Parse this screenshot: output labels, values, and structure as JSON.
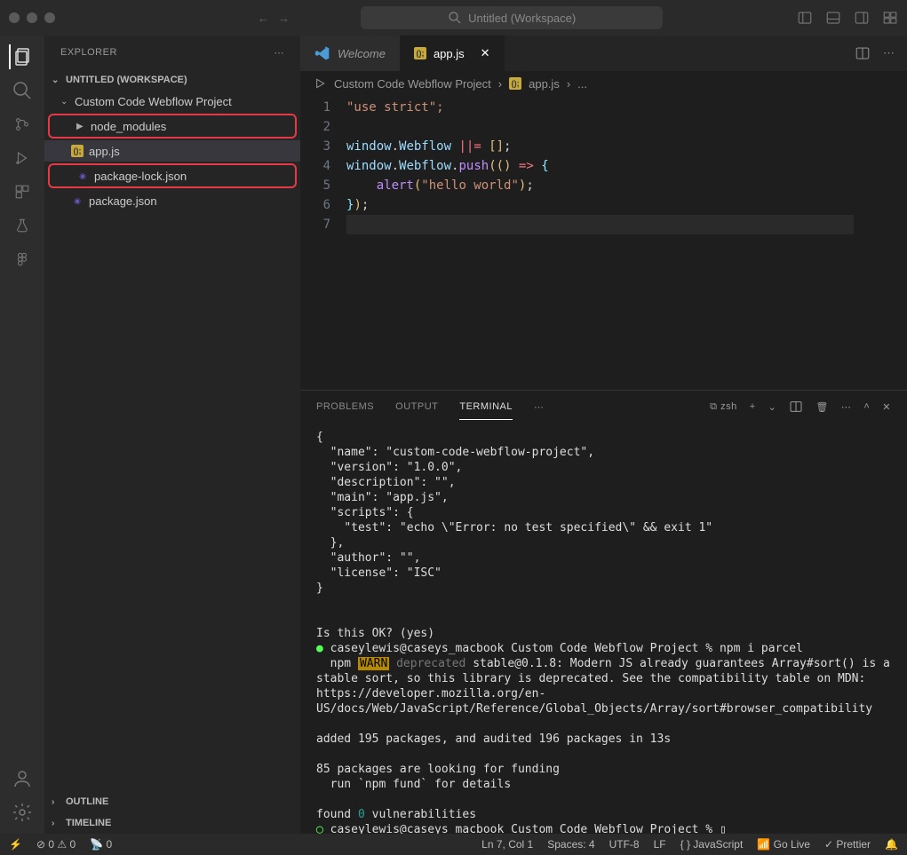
{
  "title_bar": {
    "search_label": "Untitled (Workspace)"
  },
  "sidebar": {
    "header": "EXPLORER",
    "workspace": "UNTITLED (WORKSPACE)",
    "project": "Custom Code Webflow Project",
    "items": [
      {
        "label": "node_modules"
      },
      {
        "label": "app.js"
      },
      {
        "label": "package-lock.json"
      },
      {
        "label": "package.json"
      }
    ],
    "outline": "OUTLINE",
    "timeline": "TIMELINE"
  },
  "tabs": {
    "welcome": "Welcome",
    "active": "app.js"
  },
  "breadcrumb": {
    "a": "Custom Code Webflow Project",
    "b": "app.js",
    "c": "..."
  },
  "code": {
    "l1": "\"use strict\";",
    "l3a": "window",
    "l3b": ".",
    "l3c": "Webflow",
    "l3d": " ||= ",
    "l3e": "[]",
    "l3f": ";",
    "l4a": "window",
    "l4b": ".",
    "l4c": "Webflow",
    "l4d": ".",
    "l4e": "push",
    "l4f": "(()",
    "l4g": " => ",
    "l4h": "{",
    "l5a": "    alert",
    "l5b": "(",
    "l5c": "\"hello world\"",
    "l5d": ")",
    "l5e": ";",
    "l6a": "}",
    "l6b": ")",
    "l6c": ";"
  },
  "panel": {
    "problems": "PROBLEMS",
    "output": "OUTPUT",
    "terminal": "TERMINAL",
    "shell": "zsh"
  },
  "terminal_output": "{\n  \"name\": \"custom-code-webflow-project\",\n  \"version\": \"1.0.0\",\n  \"description\": \"\",\n  \"main\": \"app.js\",\n  \"scripts\": {\n    \"test\": \"echo \\\"Error: no test specified\\\" && exit 1\"\n  },\n  \"author\": \"\",\n  \"license\": \"ISC\"\n}\n\n\nIs this OK? (yes)",
  "terminal_prompt1": "caseylewis@caseys_macbook Custom Code Webflow Project % npm i parcel",
  "terminal_npm": "npm ",
  "terminal_warn": "WARN",
  "terminal_dep": " deprecated",
  "terminal_depmsg": " stable@0.1.8: Modern JS already guarantees Array#sort() is a stable sort, so this library is deprecated. See the compatibility table on MDN: https://developer.mozilla.org/en-US/docs/Web/JavaScript/Reference/Global_Objects/Array/sort#browser_compatibility",
  "terminal_added": "\nadded 195 packages, and audited 196 packages in 13s\n\n85 packages are looking for funding\n  run `npm fund` for details\n\nfound ",
  "terminal_zero": "0",
  "terminal_vuln": " vulnerabilities",
  "terminal_prompt2": "caseylewis@caseys_macbook Custom Code Webflow Project % ",
  "status": {
    "err": "0",
    "warn": "0",
    "port": "0",
    "ln": "Ln 7, Col 1",
    "spaces": "Spaces: 4",
    "enc": "UTF-8",
    "eol": "LF",
    "lang": "JavaScript",
    "live": "Go Live",
    "prettier": "Prettier"
  }
}
